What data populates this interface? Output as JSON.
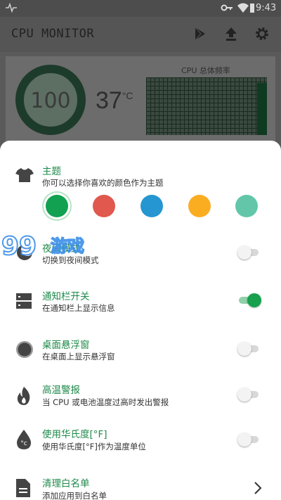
{
  "statusbar": {
    "time": "9:43"
  },
  "appbar": {
    "title": "CPU MONITOR",
    "icons": [
      "play-store-icon",
      "upload-icon",
      "settings-icon"
    ]
  },
  "dashboard": {
    "usage": "100",
    "temperature": "37",
    "temp_unit": "°C",
    "freq_title": "CPU 总体频率"
  },
  "theme": {
    "title": "主题",
    "subtitle": "你可以选择你喜欢的颜色作为主题",
    "colors": [
      "#11a150",
      "#e0584e",
      "#2596d1",
      "#fbad22",
      "#63c6a8"
    ],
    "selected_index": 0
  },
  "settings": [
    {
      "key": "night",
      "title": "夜间模式",
      "subtitle": "切换到夜间模式",
      "on": false
    },
    {
      "key": "notify",
      "title": "通知栏开关",
      "subtitle": "在通知栏上显示信息",
      "on": true
    },
    {
      "key": "float",
      "title": "桌面悬浮窗",
      "subtitle": "在桌面上显示悬浮窗",
      "on": false
    },
    {
      "key": "alarm",
      "title": "高温警报",
      "subtitle": "当 CPU 或电池温度过高时发出警报",
      "on": false
    },
    {
      "key": "fahrenheit",
      "title": "使用华氏度[°F]",
      "subtitle": "使用华氏度[°F]作为温度单位",
      "on": false
    },
    {
      "key": "whitelist",
      "title": "清理白名单",
      "subtitle": "添加应用到白名单"
    }
  ],
  "watermark": {
    "text": "游戏"
  }
}
